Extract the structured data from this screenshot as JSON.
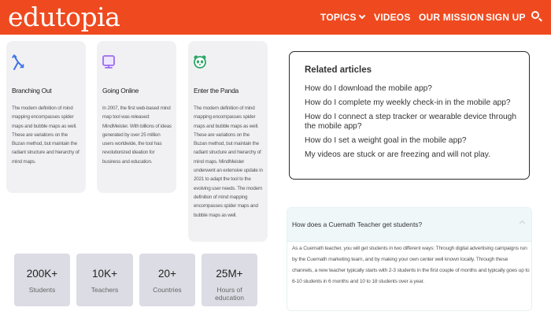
{
  "brand": {
    "logo": "edutopia",
    "accent": "#ef4a1f"
  },
  "nav": {
    "topics": "TOPICS",
    "videos": "VIDEOS",
    "mission": "OUR MISSION",
    "signup": "SIGN UP"
  },
  "cards": [
    {
      "icon": "branch-arrows-icon",
      "title": "Branching Out",
      "body": "The modern definition of mind mapping encompasses spider maps and bubble maps as well. These are variations on the Buzan method, but maintain the radiant structure and hierarchy of mind maps."
    },
    {
      "icon": "monitor-icon",
      "title": "Going Online",
      "body": "In 2007, the first web-based mind map tool was released: MindMeister. With billions of ideas generated by over 25 million users worldwide, the tool has revolutionized ideation for business and education."
    },
    {
      "icon": "panda-icon",
      "title": "Enter the Panda",
      "body": "The modern definition of mind mapping encompasses spider maps and bubble maps as well. These are variations on the Buzan method, but maintain the radiant structure and hierarchy of mind maps. MindMeister underwent an extensive update in 2021 to adapt the tool to the evolving user needs. The modern definition of mind mapping encompasses spider maps and bubble maps as well."
    }
  ],
  "stats": [
    {
      "value": "200K+",
      "label": "Students"
    },
    {
      "value": "10K+",
      "label": "Teachers"
    },
    {
      "value": "20+",
      "label": "Countries"
    },
    {
      "value": "25M+",
      "label": "Hours of education"
    }
  ],
  "related": {
    "title": "Related articles",
    "items": [
      "How do I download the mobile app?",
      "How do I complete my weekly check-in in the mobile app?",
      "How do I connect a step tracker or wearable device through the mobile app?",
      "How do I set a weight goal in the mobile app?",
      "My videos are stuck or are freezing and will not play."
    ]
  },
  "faq": {
    "question": "How does a Cuemath Teacher get students?",
    "answer": "As a Cuemath teacher, you will get students in two different ways: Through digital advertising campaigns run by the Cuemath marketing team, and by making your own center well known locally. Through these channels, a new teacher typically starts with 2-3 students in the first couple of months and typically goes up to 6-10 students in 6 months and 10 to 18 students over a year."
  }
}
